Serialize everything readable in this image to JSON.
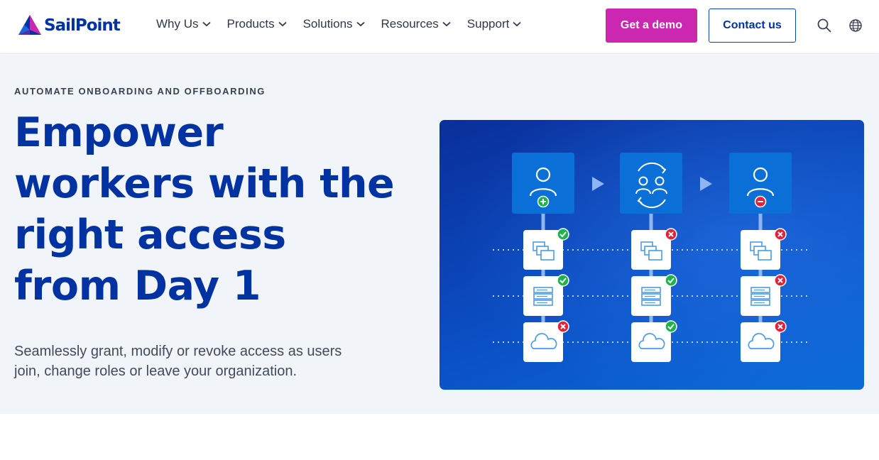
{
  "brand": {
    "name": "SailPoint"
  },
  "nav": {
    "items": [
      {
        "label": "Why Us"
      },
      {
        "label": "Products"
      },
      {
        "label": "Solutions"
      },
      {
        "label": "Resources"
      },
      {
        "label": "Support"
      }
    ]
  },
  "header": {
    "demo_label": "Get a demo",
    "contact_label": "Contact us",
    "icons": [
      "search-icon",
      "globe-icon"
    ]
  },
  "hero": {
    "eyebrow": "AUTOMATE ONBOARDING AND OFFBOARDING",
    "headline_lines": [
      "Empower",
      "workers with the",
      "right access",
      "from Day 1"
    ],
    "subtext": "Seamlessly grant, modify or revoke access as users join, change roles or leave your organization."
  },
  "illustration": {
    "stages": [
      {
        "icon": "user-icon",
        "badge": "add"
      },
      {
        "icon": "users-sync-icon",
        "badge": "none"
      },
      {
        "icon": "user-icon",
        "badge": "remove"
      }
    ],
    "resources": [
      "windows-icon",
      "server-icon",
      "cloud-icon"
    ],
    "status": [
      [
        "granted",
        "revoked",
        "revoked"
      ],
      [
        "granted",
        "granted",
        "revoked"
      ],
      [
        "revoked",
        "granted",
        "revoked"
      ]
    ]
  },
  "colors": {
    "brand_blue": "#0033a1",
    "demo_magenta": "#cc27b0",
    "hero_bg": "#f1f4f8",
    "granted_green": "#1cb34a",
    "revoked_red": "#e0223a"
  }
}
